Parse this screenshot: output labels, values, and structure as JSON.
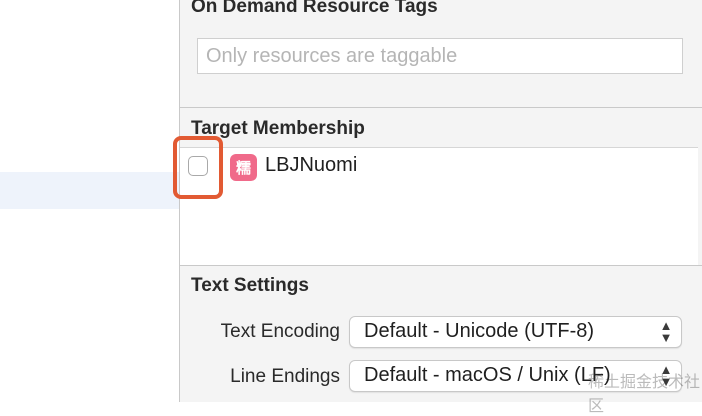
{
  "on_demand": {
    "title": "On Demand Resource Tags",
    "placeholder": "Only resources are taggable"
  },
  "target_membership": {
    "title": "Target Membership",
    "targets": [
      {
        "name": "LBJNuomi",
        "checked": false,
        "icon_glyph": "糯"
      }
    ]
  },
  "text_settings": {
    "title": "Text Settings",
    "encoding_label": "Text Encoding",
    "encoding_value": "Default - Unicode (UTF-8)",
    "line_endings_label": "Line Endings",
    "line_endings_value": "Default - macOS / Unix (LF)"
  },
  "watermark": "稀土掘金技术社区",
  "colors": {
    "highlight_ring": "#e25a33",
    "app_icon": "#f06a8a"
  }
}
